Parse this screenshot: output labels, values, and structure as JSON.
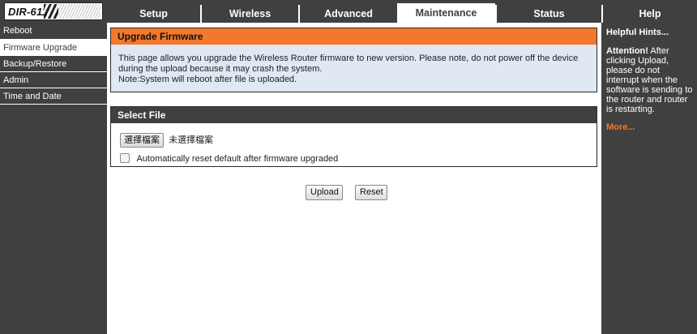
{
  "logo": {
    "text": "DIR-611"
  },
  "nav": {
    "tabs": [
      {
        "label": "Setup"
      },
      {
        "label": "Wireless"
      },
      {
        "label": "Advanced"
      },
      {
        "label": "Maintenance",
        "active": true
      },
      {
        "label": "Status"
      },
      {
        "label": "Help"
      }
    ]
  },
  "sidebar": {
    "items": [
      {
        "label": "Reboot"
      },
      {
        "label": "Firmware Upgrade",
        "active": true
      },
      {
        "label": "Backup/Restore"
      },
      {
        "label": "Admin"
      },
      {
        "label": "Time and Date"
      }
    ]
  },
  "upgrade": {
    "title": "Upgrade Firmware",
    "line1": "This page allows you upgrade the Wireless Router firmware to new version. Please note, do not power off the device",
    "line2": "during the upload because it may crash the system.",
    "line3": "Note:System will reboot after file is uploaded."
  },
  "select_file": {
    "title": "Select File",
    "choose_button": "選擇檔案",
    "file_status": "未選擇檔案",
    "auto_reset_label": "Automatically reset default after firmware upgraded",
    "auto_reset_checked": false
  },
  "actions": {
    "upload": "Upload",
    "reset": "Reset"
  },
  "help": {
    "title": "Helpful Hints...",
    "attention_label": "Attention!",
    "attention_text": " After clicking Upload, please do not interrupt when the software is sending to the router and router is restarting.",
    "more": "More..."
  },
  "colors": {
    "nav_bg": "#404040",
    "accent": "#f4782b",
    "info_bg": "#dfe8f3"
  }
}
